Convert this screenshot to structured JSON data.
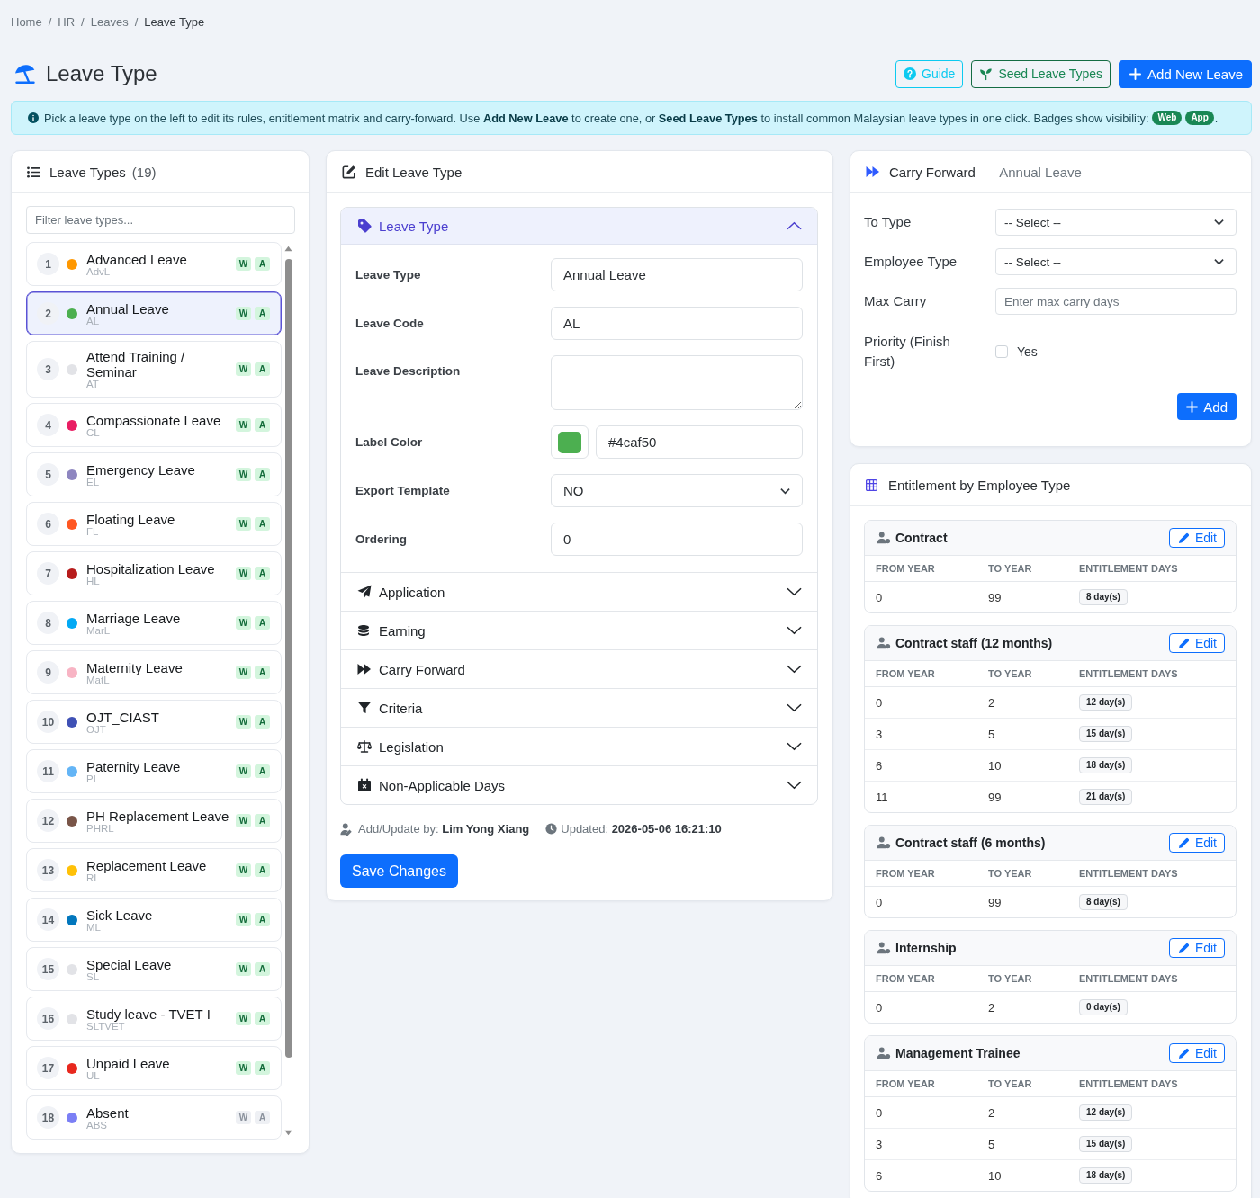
{
  "breadcrumb": [
    {
      "label": "Home",
      "current": false,
      "separator": "/"
    },
    {
      "label": "HR",
      "current": false,
      "separator": "/"
    },
    {
      "label": "Leaves",
      "current": false,
      "separator": "/"
    },
    {
      "label": "Leave Type",
      "current": true
    }
  ],
  "page_title": "Leave Type",
  "actions": [
    {
      "label": "Guide",
      "kind": "guide"
    },
    {
      "label": "Seed Leave Types",
      "kind": "seed"
    },
    {
      "label": "Add New Leave",
      "kind": "add"
    }
  ],
  "alert": {
    "text": "Pick a leave type on the left to edit its rules, entitlement matrix and carry-forward. Use **Add New Leave** to create one, or **Seed Leave Types** to install common Malaysian leave types in one click. Badges show visibility:",
    "badges": [
      "Web",
      "App"
    ],
    "end": "."
  },
  "leave_types": {
    "title": "Leave Types",
    "count": "(19)",
    "filter_placeholder": "Filter leave types...",
    "items": [
      {
        "number": "1",
        "name": "Advanced Leave",
        "code": "AdvL",
        "color": "#ff9800",
        "selected": false,
        "badges": [
          {
            "label": "W",
            "on": true
          },
          {
            "label": "A",
            "on": true
          }
        ]
      },
      {
        "number": "2",
        "name": "Annual Leave",
        "code": "AL",
        "color": "#4caf50",
        "selected": true,
        "badges": [
          {
            "label": "W",
            "on": true
          },
          {
            "label": "A",
            "on": true
          }
        ]
      },
      {
        "number": "3",
        "name": "Attend Training / Seminar",
        "code": "AT",
        "color": "#e2e3e7",
        "selected": false,
        "badges": [
          {
            "label": "W",
            "on": true
          },
          {
            "label": "A",
            "on": true
          }
        ]
      },
      {
        "number": "4",
        "name": "Compassionate Leave",
        "code": "CL",
        "color": "#e91e63",
        "selected": false,
        "badges": [
          {
            "label": "W",
            "on": true
          },
          {
            "label": "A",
            "on": true
          }
        ]
      },
      {
        "number": "5",
        "name": "Emergency Leave",
        "code": "EL",
        "color": "#8e86c0",
        "selected": false,
        "badges": [
          {
            "label": "W",
            "on": true
          },
          {
            "label": "A",
            "on": true
          }
        ]
      },
      {
        "number": "6",
        "name": "Floating Leave",
        "code": "FL",
        "color": "#ff5722",
        "selected": false,
        "badges": [
          {
            "label": "W",
            "on": true
          },
          {
            "label": "A",
            "on": true
          }
        ]
      },
      {
        "number": "7",
        "name": "Hospitalization Leave",
        "code": "HL",
        "color": "#b71c1c",
        "selected": false,
        "badges": [
          {
            "label": "W",
            "on": true
          },
          {
            "label": "A",
            "on": true
          }
        ]
      },
      {
        "number": "8",
        "name": "Marriage Leave",
        "code": "MarL",
        "color": "#03a9f4",
        "selected": false,
        "badges": [
          {
            "label": "W",
            "on": true
          },
          {
            "label": "A",
            "on": true
          }
        ]
      },
      {
        "number": "9",
        "name": "Maternity Leave",
        "code": "MatL",
        "color": "#f8b4c4",
        "selected": false,
        "badges": [
          {
            "label": "W",
            "on": true
          },
          {
            "label": "A",
            "on": true
          }
        ]
      },
      {
        "number": "10",
        "name": "OJT_CIAST",
        "code": "OJT",
        "color": "#3f51b5",
        "selected": false,
        "badges": [
          {
            "label": "W",
            "on": true
          },
          {
            "label": "A",
            "on": true
          }
        ]
      },
      {
        "number": "11",
        "name": "Paternity Leave",
        "code": "PL",
        "color": "#64b5f6",
        "selected": false,
        "badges": [
          {
            "label": "W",
            "on": true
          },
          {
            "label": "A",
            "on": true
          }
        ]
      },
      {
        "number": "12",
        "name": "PH Replacement Leave",
        "code": "PHRL",
        "color": "#795548",
        "selected": false,
        "badges": [
          {
            "label": "W",
            "on": true
          },
          {
            "label": "A",
            "on": true
          }
        ]
      },
      {
        "number": "13",
        "name": "Replacement Leave",
        "code": "RL",
        "color": "#ffc107",
        "selected": false,
        "badges": [
          {
            "label": "W",
            "on": true
          },
          {
            "label": "A",
            "on": true
          }
        ]
      },
      {
        "number": "14",
        "name": "Sick Leave",
        "code": "ML",
        "color": "#0277bd",
        "selected": false,
        "badges": [
          {
            "label": "W",
            "on": true
          },
          {
            "label": "A",
            "on": true
          }
        ]
      },
      {
        "number": "15",
        "name": "Special Leave",
        "code": "SL",
        "color": "#e2e3e7",
        "selected": false,
        "badges": [
          {
            "label": "W",
            "on": true
          },
          {
            "label": "A",
            "on": true
          }
        ]
      },
      {
        "number": "16",
        "name": "Study leave - TVET I",
        "code": "SLTVET",
        "color": "#e2e3e7",
        "selected": false,
        "badges": [
          {
            "label": "W",
            "on": true
          },
          {
            "label": "A",
            "on": true
          }
        ]
      },
      {
        "number": "17",
        "name": "Unpaid Leave",
        "code": "UL",
        "color": "#e8281e",
        "selected": false,
        "badges": [
          {
            "label": "W",
            "on": true
          },
          {
            "label": "A",
            "on": true
          }
        ]
      },
      {
        "number": "18",
        "name": "Absent",
        "code": "ABS",
        "color": "#7b7ff5",
        "selected": false,
        "badges": [
          {
            "label": "W",
            "on": false
          },
          {
            "label": "A",
            "on": false
          }
        ]
      }
    ]
  },
  "editor": {
    "title": "Edit Leave Type",
    "sections": [
      {
        "title": "Leave Type",
        "expanded": true,
        "fields": [
          {
            "label": "Leave Type",
            "kind": "text",
            "value": "Annual Leave"
          },
          {
            "label": "Leave Code",
            "kind": "text",
            "value": "AL"
          },
          {
            "label": "Leave Description",
            "kind": "textarea"
          },
          {
            "label": "Label Color",
            "kind": "color",
            "value": "#4caf50"
          },
          {
            "label": "Export Template",
            "kind": "select",
            "value": "NO"
          },
          {
            "label": "Ordering",
            "kind": "text",
            "value": "0"
          }
        ]
      },
      {
        "title": "Application",
        "expanded": false
      },
      {
        "title": "Earning",
        "expanded": false
      },
      {
        "title": "Carry Forward",
        "expanded": false
      },
      {
        "title": "Criteria",
        "expanded": false
      },
      {
        "title": "Legislation",
        "expanded": false
      },
      {
        "title": "Non-Applicable Days",
        "expanded": false
      }
    ],
    "meta": [
      "Add/Update by: **Lim Yong Xiang**",
      "Updated: **2026-05-06 16:21:10**"
    ],
    "save_label": "Save Changes"
  },
  "carry_forward": {
    "title": "Carry Forward",
    "subtitle": "— Annual Leave",
    "fields": [
      {
        "label": "To Type",
        "kind": "select",
        "value": "-- Select --"
      },
      {
        "label": "Employee Type",
        "kind": "select",
        "value": "-- Select --"
      },
      {
        "label": "Max Carry",
        "kind": "input",
        "placeholder": "Enter max carry days"
      },
      {
        "label": "Priority (Finish First)",
        "kind": "checkbox",
        "option": "Yes",
        "checked": false
      }
    ],
    "add_label": "Add"
  },
  "entitlement": {
    "title": "Entitlement by Employee Type",
    "groups": [
      {
        "name": "Contract",
        "edit_label": "Edit",
        "columns": [
          "FROM YEAR",
          "TO YEAR",
          "ENTITLEMENT DAYS"
        ],
        "rows": [
          {
            "from": "0",
            "to": "99",
            "days": "8 day(s)"
          }
        ]
      },
      {
        "name": "Contract staff (12 months)",
        "edit_label": "Edit",
        "columns": [
          "FROM YEAR",
          "TO YEAR",
          "ENTITLEMENT DAYS"
        ],
        "rows": [
          {
            "from": "0",
            "to": "2",
            "days": "12 day(s)"
          },
          {
            "from": "3",
            "to": "5",
            "days": "15 day(s)"
          },
          {
            "from": "6",
            "to": "10",
            "days": "18 day(s)"
          },
          {
            "from": "11",
            "to": "99",
            "days": "21 day(s)"
          }
        ]
      },
      {
        "name": "Contract staff (6 months)",
        "edit_label": "Edit",
        "columns": [
          "FROM YEAR",
          "TO YEAR",
          "ENTITLEMENT DAYS"
        ],
        "rows": [
          {
            "from": "0",
            "to": "99",
            "days": "8 day(s)"
          }
        ]
      },
      {
        "name": "Internship",
        "edit_label": "Edit",
        "columns": [
          "FROM YEAR",
          "TO YEAR",
          "ENTITLEMENT DAYS"
        ],
        "rows": [
          {
            "from": "0",
            "to": "2",
            "days": "0 day(s)"
          }
        ]
      },
      {
        "name": "Management Trainee",
        "edit_label": "Edit",
        "columns": [
          "FROM YEAR",
          "TO YEAR",
          "ENTITLEMENT DAYS"
        ],
        "rows": [
          {
            "from": "0",
            "to": "2",
            "days": "12 day(s)"
          },
          {
            "from": "3",
            "to": "5",
            "days": "15 day(s)"
          },
          {
            "from": "6",
            "to": "10",
            "days": "18 day(s)"
          }
        ]
      }
    ]
  }
}
